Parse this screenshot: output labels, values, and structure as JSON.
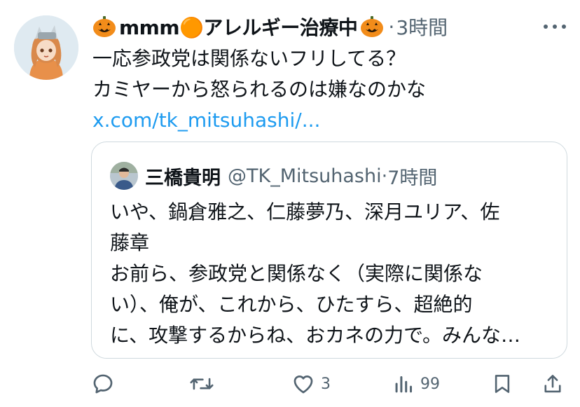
{
  "tweet": {
    "display_name": "mmm🟠アレルギー治療中",
    "separator": "·",
    "time": "3時間",
    "text_lines": [
      "一応参政党は関係ないフリしてる？",
      "カミヤーから怒られるのは嫌なのかな"
    ],
    "link": "x.com/tk_mitsuhashi/...",
    "avatar_icon": "anime-avatar-icon",
    "name_emoji_icon": "jack-o-lantern-icon"
  },
  "quote": {
    "display_name": "三橋貴明",
    "handle": "@TK_Mitsuhashi",
    "separator": "·",
    "time": "7時間",
    "text_lines": [
      "いや、鍋倉雅之、仁藤夢乃、深月ユリア、佐",
      "藤章",
      "お前ら、参政党と関係なく（実際に関係な",
      "い）、俺が、これから、ひたすら、超絶的",
      "に、攻撃するからね、おカネの力で。みんな…"
    ]
  },
  "actions": {
    "reply_count": "",
    "retweet_count": "",
    "like_count": "3",
    "views_count": "99"
  },
  "colors": {
    "text": "#0f1419",
    "secondary": "#536471",
    "link": "#1d9bf0",
    "border": "#cfd9de"
  }
}
